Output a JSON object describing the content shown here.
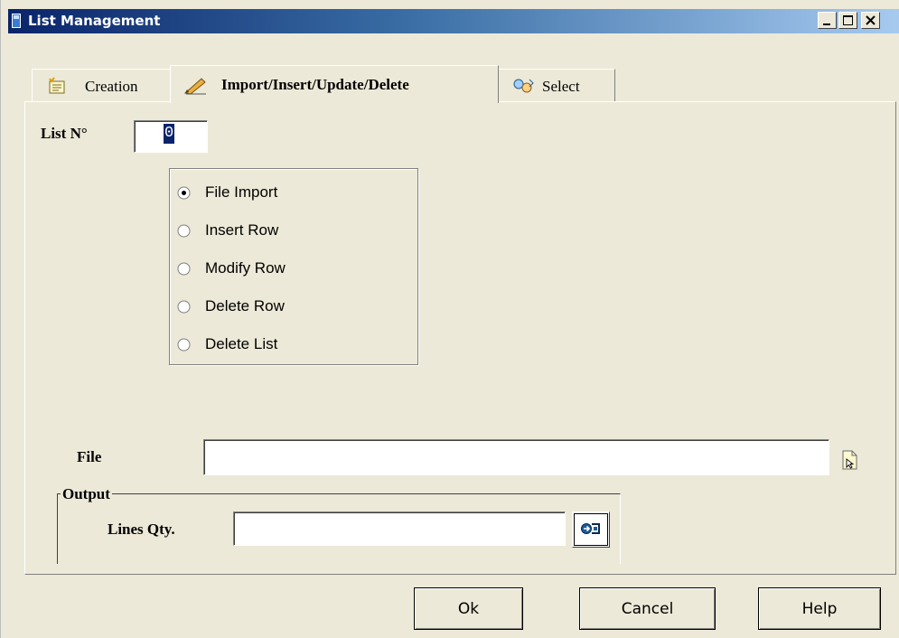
{
  "window": {
    "title": "List Management",
    "controls": {
      "minimize": "minimize-icon",
      "maximize": "maximize-icon",
      "close": "close-icon"
    }
  },
  "tabs": [
    {
      "label": "Creation",
      "icon": "list-creation-icon",
      "active": false
    },
    {
      "label": "Import/Insert/Update/Delete",
      "icon": "pencil-edit-icon",
      "active": true
    },
    {
      "label": "Select",
      "icon": "select-arrows-icon",
      "active": false
    }
  ],
  "form": {
    "list_no_label": "List N°",
    "list_no_value": "0",
    "operations": [
      {
        "label": "File Import",
        "selected": true
      },
      {
        "label": "Insert Row",
        "selected": false
      },
      {
        "label": "Modify Row",
        "selected": false
      },
      {
        "label": "Delete Row",
        "selected": false
      },
      {
        "label": "Delete List",
        "selected": false
      }
    ],
    "file_label": "File",
    "file_value": "",
    "browse_icon": "file-browse-icon",
    "output": {
      "legend": "Output",
      "lines_qty_label": "Lines Qty.",
      "lines_qty_value": "",
      "go_icon": "arrow-go-icon"
    }
  },
  "buttons": {
    "ok": "Ok",
    "cancel": "Cancel",
    "help": "Help"
  },
  "colors": {
    "titlebar_start": "#0A246A",
    "titlebar_end": "#A6CAF0",
    "face": "#ECE9D8"
  }
}
